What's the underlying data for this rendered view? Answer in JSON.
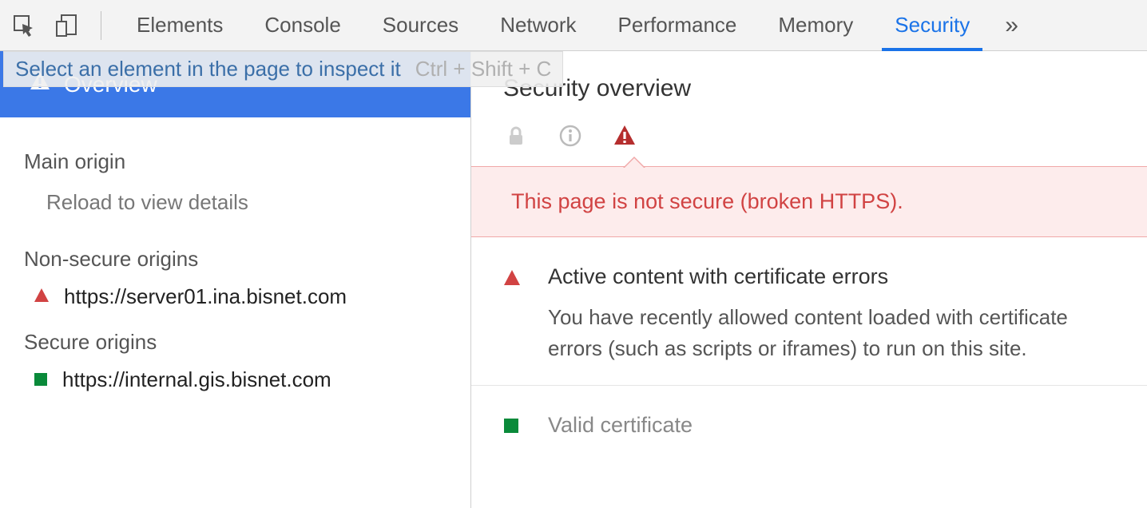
{
  "toolbar": {
    "tabs": [
      "Elements",
      "Console",
      "Sources",
      "Network",
      "Performance",
      "Memory",
      "Security"
    ],
    "active_tab_index": 6,
    "tooltip_text": "Select an element in the page to inspect it",
    "tooltip_shortcut": "Ctrl + Shift + C"
  },
  "sidebar": {
    "overview_label": "Overview",
    "main_origin_label": "Main origin",
    "main_origin_hint": "Reload to view details",
    "non_secure_label": "Non-secure origins",
    "non_secure_items": [
      "https://server01.ina.bisnet.com"
    ],
    "secure_label": "Secure origins",
    "secure_items": [
      "https://internal.gis.bisnet.com"
    ]
  },
  "panel": {
    "title": "Security overview",
    "banner_message": "This page is not secure (broken HTTPS).",
    "details": [
      {
        "heading": "Active content with certificate errors",
        "body": "You have recently allowed content loaded with certificate errors (such as scripts or iframes) to run on this site.",
        "icon": "warning-triangle"
      },
      {
        "heading": "Valid certificate",
        "body": "",
        "icon": "green-square"
      }
    ]
  }
}
